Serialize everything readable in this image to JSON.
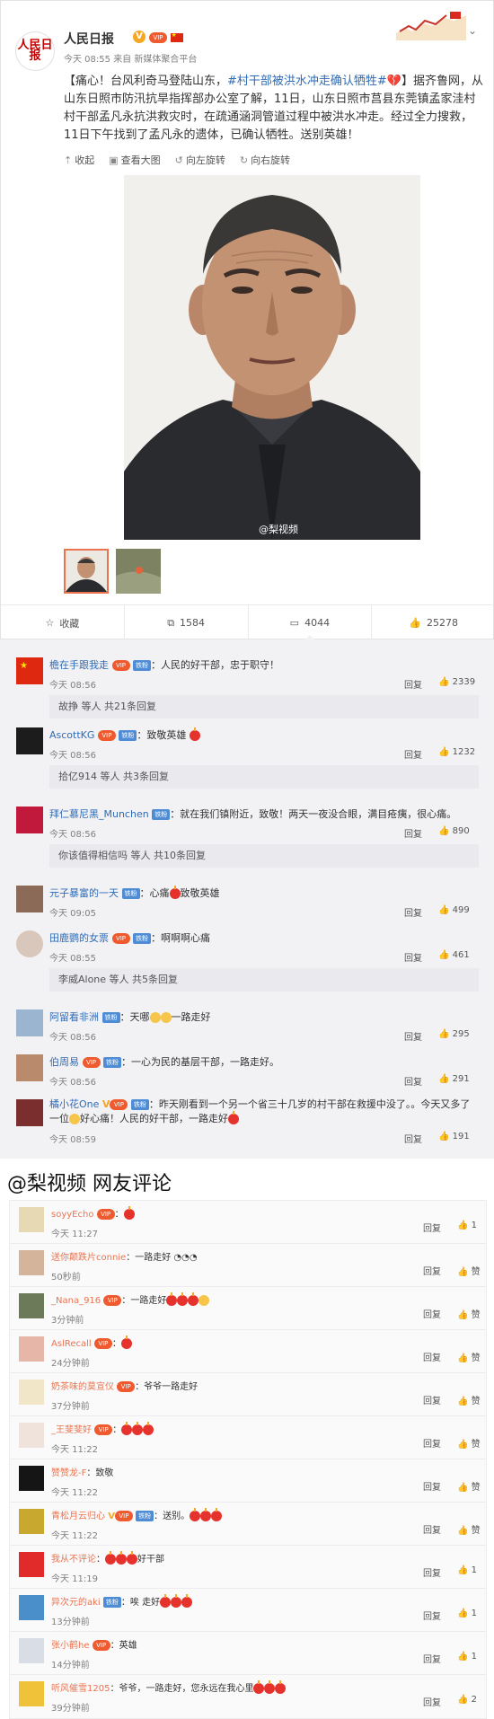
{
  "post": {
    "user_name": "人民日报",
    "logo_text": "人民日报",
    "time": "今天 08:55",
    "source": "来自 新媒体聚合平台",
    "content_prefix": "【痛心！台风利奇马登陆山东，",
    "topic": "#村干部被洪水冲走确认牺牲#",
    "content_suffix": "】据齐鲁网，从山东日照市防汛抗旱指挥部办公室了解，11日，山东日照市莒县东莞镇孟家洼村村干部孟凡永抗洪救灾时，在疏通涵洞管道过程中被洪水冲走。经过全力搜救，11日下午找到了孟凡永的遗体，已确认牺牲。送别英雄！",
    "actions": [
      "收起",
      "查看大图",
      "向左旋转",
      "向右旋转"
    ],
    "watermark": "@梨视频",
    "stats": {
      "favorite": "收藏",
      "repost": "1584",
      "comment": "4044",
      "like": "25278"
    }
  },
  "hot_comments": [
    {
      "name": "檐在手跟我走",
      "text": "：人民的好干部，忠于职守！",
      "time": "今天 08:56",
      "reply": "回复",
      "likes": "2339",
      "sub": "故挣 等人 共21条回复",
      "sub_link": "共21条回复"
    },
    {
      "name": "AscottKG",
      "text": "：致敬英雄",
      "time": "今天 08:56",
      "reply": "回复",
      "likes": "1232",
      "sub": "拾亿914 等人 共3条回复"
    },
    {
      "name": "拜仁慕尼黑_Munchen",
      "text": "：就在我们镇附近，致敬！两天一夜没合眼，满目疮痍，很心痛。",
      "time": "今天 08:56",
      "reply": "回复",
      "likes": "890",
      "sub": "你该值得相信吗 等人 共10条回复"
    },
    {
      "name": "元子暴富的一天",
      "text": "：心痛",
      "text2": "致敬英雄",
      "time": "今天 09:05",
      "reply": "回复",
      "likes": "499"
    },
    {
      "name": "田鹿鹦的女票",
      "text": "：啊啊啊心痛",
      "time": "今天 08:55",
      "reply": "回复",
      "likes": "461",
      "sub": "李威Alone 等人 共5条回复"
    },
    {
      "name": "阿留看非洲",
      "text": "：天哪",
      "text2": "一路走好",
      "time": "今天 08:56",
      "reply": "回复",
      "likes": "295"
    },
    {
      "name": "伯周易",
      "text": "：一心为民的基层干部，一路走好。",
      "time": "今天 08:56",
      "reply": "回复",
      "likes": "291"
    },
    {
      "name": "橘小花One",
      "text": "：昨天刚看到一个另一个省三十几岁的村干部在救援中没了。。今天又多了一位",
      "text2": "好心痛！人民的好干部，一路走好",
      "time": "今天 08:59",
      "reply": "回复",
      "likes": "191"
    }
  ],
  "caption": "@梨视频 网友评论",
  "video_comments": [
    {
      "name": "soyyEcho",
      "text": "：",
      "time": "今天 11:27",
      "reply": "回复",
      "likes": "1"
    },
    {
      "name": "送你颠跌片connie",
      "text": "：一路走好",
      "time": "50秒前",
      "reply": "回复",
      "likes": "赞"
    },
    {
      "name": "_Nana_916",
      "text": "：一路走好",
      "time": "3分钟前",
      "reply": "回复",
      "likes": "赞"
    },
    {
      "name": "AslRecall",
      "text": "：",
      "time": "24分钟前",
      "reply": "回复",
      "likes": "赞"
    },
    {
      "name": "奶茶味的莫宣仪",
      "text": "：爷爷一路走好",
      "time": "37分钟前",
      "reply": "回复",
      "likes": "赞"
    },
    {
      "name": "_王斐斐好",
      "text": "：",
      "time": "今天 11:22",
      "reply": "回复",
      "likes": "赞"
    },
    {
      "name": "赞赞龙-F",
      "text": "：致敬",
      "time": "今天 11:22",
      "reply": "回复",
      "likes": "赞"
    },
    {
      "name": "青松月云归心",
      "text": "：送别。",
      "time": "今天 11:22",
      "reply": "回复",
      "likes": "赞"
    },
    {
      "name": "我从不评论",
      "text": "：",
      "text2": "好干部",
      "time": "今天 11:19",
      "reply": "回复",
      "likes": "1"
    },
    {
      "name": "异次元的aki",
      "text": "：唉 走好",
      "time": "13分钟前",
      "reply": "回复",
      "likes": "1"
    },
    {
      "name": "张小鹤he",
      "text": "：英雄",
      "time": "14分钟前",
      "reply": "回复",
      "likes": "1"
    },
    {
      "name": "听风催雪1205",
      "text": "：爷爷，一路走好，您永远在我心里",
      "time": "39分钟前",
      "reply": "回复",
      "likes": "2"
    }
  ],
  "colors": {
    "accent": "#eb7350",
    "link": "#2f6bb6",
    "panel": "#f2f2f5"
  }
}
